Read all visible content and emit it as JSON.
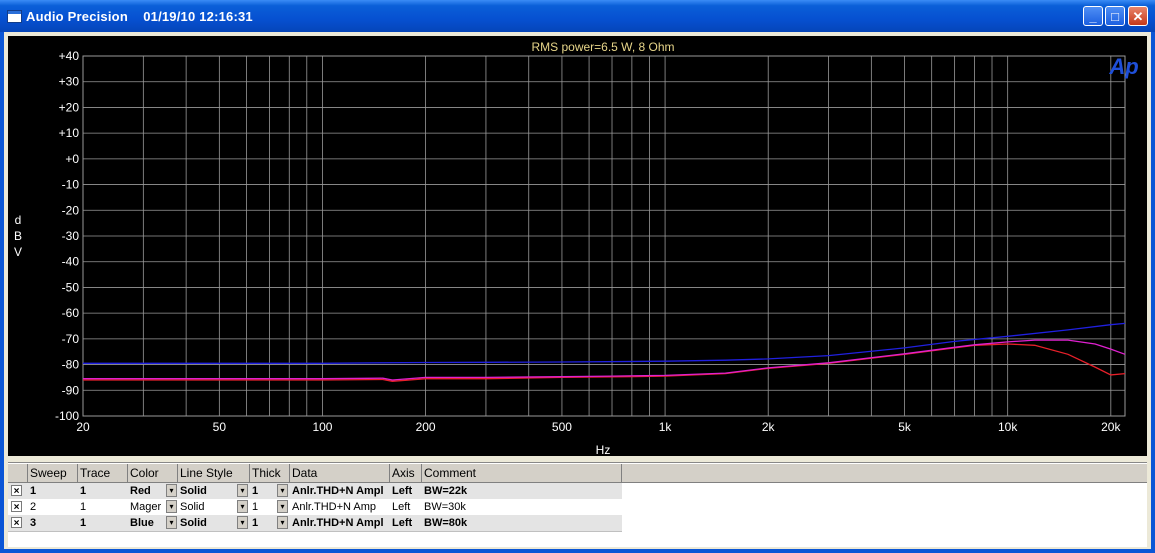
{
  "window": {
    "title": "Audio Precision    01/19/10 12:16:31",
    "minimize_glyph": "_",
    "maximize_glyph": "□",
    "close_glyph": "✕"
  },
  "colors": {
    "plot_bg": "#000000",
    "grid": "#9a9a9a",
    "axis_text": "#ffffff",
    "title_text": "#e8d68a",
    "trace_red": "#e8202a",
    "trace_magenta": "#e020d0",
    "trace_blue": "#2020e0",
    "logo": "#1f4fd8"
  },
  "chart_data": {
    "type": "line",
    "title": "RMS power=6.5 W, 8 Ohm",
    "xlabel": "Hz",
    "ylabel": "dBV",
    "x_scale": "log",
    "xlim": [
      20,
      22000
    ],
    "ylim": [
      -100,
      40
    ],
    "x_ticks": [
      {
        "v": 20,
        "label": "20"
      },
      {
        "v": 50,
        "label": "50"
      },
      {
        "v": 100,
        "label": "100"
      },
      {
        "v": 200,
        "label": "200"
      },
      {
        "v": 500,
        "label": "500"
      },
      {
        "v": 1000,
        "label": "1k"
      },
      {
        "v": 2000,
        "label": "2k"
      },
      {
        "v": 5000,
        "label": "5k"
      },
      {
        "v": 10000,
        "label": "10k"
      },
      {
        "v": 20000,
        "label": "20k"
      }
    ],
    "y_ticks": [
      {
        "v": 40,
        "label": "+40"
      },
      {
        "v": 30,
        "label": "+30"
      },
      {
        "v": 20,
        "label": "+20"
      },
      {
        "v": 10,
        "label": "+10"
      },
      {
        "v": 0,
        "label": "+0"
      },
      {
        "v": -10,
        "label": "-10"
      },
      {
        "v": -20,
        "label": "-20"
      },
      {
        "v": -30,
        "label": "-30"
      },
      {
        "v": -40,
        "label": "-40"
      },
      {
        "v": -50,
        "label": "-50"
      },
      {
        "v": -60,
        "label": "-60"
      },
      {
        "v": -70,
        "label": "-70"
      },
      {
        "v": -80,
        "label": "-80"
      },
      {
        "v": -90,
        "label": "-90"
      },
      {
        "v": -100,
        "label": "-100"
      }
    ],
    "grid": true,
    "series": [
      {
        "color": "#e8202a",
        "x": [
          20,
          50,
          100,
          150,
          160,
          200,
          300,
          500,
          700,
          1000,
          1500,
          2000,
          3000,
          5000,
          7000,
          8000,
          10000,
          12000,
          15000,
          18000,
          20000,
          22000
        ],
        "y": [
          -86,
          -86,
          -86,
          -85.8,
          -86.5,
          -85.5,
          -85.5,
          -85,
          -84.8,
          -84.5,
          -83.5,
          -81.5,
          -79.5,
          -76,
          -73.5,
          -72.5,
          -72,
          -72.5,
          -76,
          -81,
          -84,
          -83.5
        ]
      },
      {
        "color": "#e020d0",
        "x": [
          20,
          50,
          100,
          150,
          160,
          200,
          300,
          500,
          700,
          1000,
          1500,
          2000,
          3000,
          5000,
          7000,
          8000,
          10000,
          12000,
          15000,
          18000,
          20000,
          22000
        ],
        "y": [
          -85.5,
          -85.5,
          -85.5,
          -85.3,
          -86,
          -85,
          -85,
          -84.7,
          -84.5,
          -84.2,
          -83.3,
          -81.3,
          -79.3,
          -75.8,
          -73.3,
          -72.3,
          -71.2,
          -70.5,
          -70.5,
          -72,
          -74,
          -76
        ]
      },
      {
        "color": "#2020e0",
        "x": [
          20,
          50,
          100,
          150,
          200,
          300,
          500,
          1000,
          1500,
          2000,
          3000,
          5000,
          7000,
          10000,
          15000,
          20000,
          22000
        ],
        "y": [
          -79.5,
          -79.5,
          -79.5,
          -79.3,
          -79.2,
          -79.1,
          -79,
          -78.7,
          -78.3,
          -77.8,
          -76.5,
          -73.5,
          -71,
          -69,
          -66.5,
          -64.5,
          -64
        ]
      }
    ]
  },
  "legend": {
    "headers": [
      "Sweep",
      "Trace",
      "Color",
      "Line Style",
      "Thick",
      "Data",
      "Axis",
      "Comment"
    ],
    "check_glyph": "×",
    "dropdown_glyph": "▾",
    "rows": [
      {
        "sweep": "1",
        "trace": "1",
        "color": "Red",
        "line_style": "Solid",
        "thick": "1",
        "data": "Anlr.THD+N Ampl",
        "axis": "Left",
        "comment": "BW=22k"
      },
      {
        "sweep": "2",
        "trace": "1",
        "color": "Mager",
        "line_style": "Solid",
        "thick": "1",
        "data": "Anlr.THD+N Amp",
        "axis": "Left",
        "comment": "BW=30k"
      },
      {
        "sweep": "3",
        "trace": "1",
        "color": "Blue",
        "line_style": "Solid",
        "thick": "1",
        "data": "Anlr.THD+N Ampl",
        "axis": "Left",
        "comment": "BW=80k"
      }
    ]
  },
  "logo": {
    "text": "Ap"
  }
}
